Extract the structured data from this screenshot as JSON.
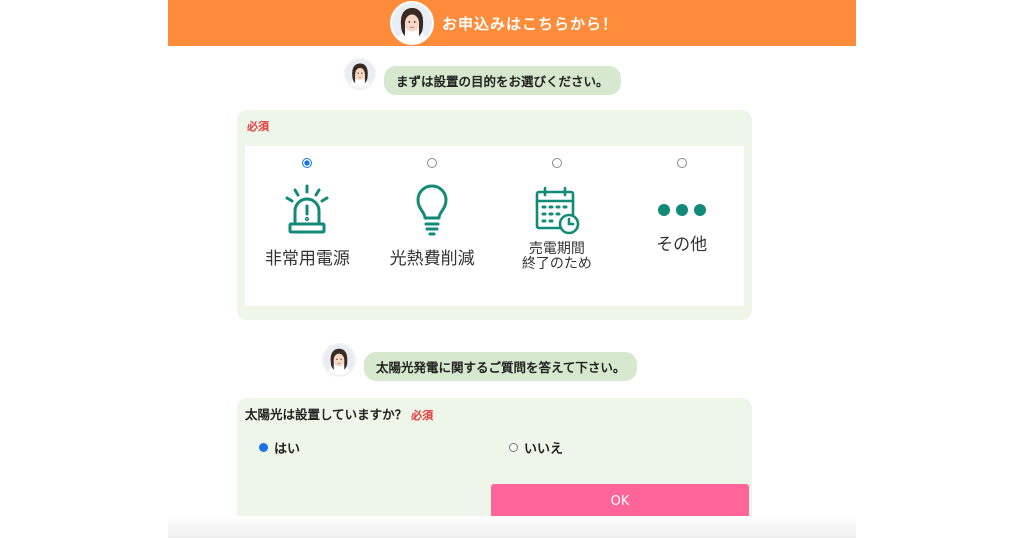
{
  "header": {
    "title": "お申込みはこちらから！"
  },
  "step1": {
    "prompt": "まずは設置の目的をお選びください。",
    "required": "必須",
    "options": [
      {
        "label": "非常用電源",
        "icon": "emergency-light-icon",
        "selected": true
      },
      {
        "label": "光熱費削減",
        "icon": "lightbulb-icon",
        "selected": false
      },
      {
        "label_line1": "売電期間",
        "label_line2": "終了のため",
        "icon": "calendar-clock-icon",
        "selected": false
      },
      {
        "label": "その他",
        "icon": "three-dots-icon",
        "selected": false
      }
    ]
  },
  "step2": {
    "prompt": "太陽光発電に関するご質問を答えて下さい。",
    "question": "太陽光は設置していますか？",
    "required": "必須",
    "yes": "はい",
    "no": "いいえ",
    "selected": "yes",
    "ok_label": "OK"
  },
  "colors": {
    "header": "#ff8c3b",
    "bubble": "#d6e8cd",
    "card": "#eef5e9",
    "icon_teal": "#128a78",
    "required_red": "#e33b3b",
    "ok_button": "#ff6599",
    "radio_blue": "#1a73e8"
  }
}
